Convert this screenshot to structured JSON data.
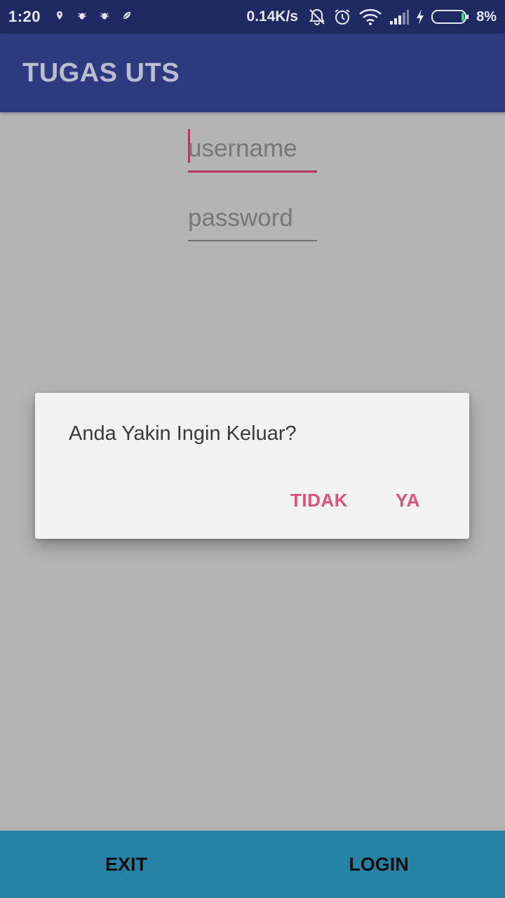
{
  "status_bar": {
    "time": "1:20",
    "notification_icons": [
      "location-icon",
      "bug-icon",
      "bug-icon",
      "leaf-icon"
    ],
    "net_speed": "0.14K/s",
    "icons": [
      "bell-off-icon",
      "alarm-icon",
      "wifi-icon",
      "signal-icon",
      "charging-icon",
      "battery-icon"
    ],
    "battery": "8%"
  },
  "app_bar": {
    "title": "TUGAS UTS"
  },
  "form": {
    "username_placeholder": "username",
    "password_placeholder": "password"
  },
  "dialog": {
    "message": "Anda Yakin Ingin Keluar?",
    "negative": "TIDAK",
    "positive": "YA"
  },
  "bottom_bar": {
    "exit": "EXIT",
    "login": "LOGIN"
  },
  "colors": {
    "status_bar": "#1f2a63",
    "app_bar": "#2d3a80",
    "accent": "#e0507f",
    "bottom_bar": "#2683a6",
    "scrim_background": "#b4b4b4"
  }
}
